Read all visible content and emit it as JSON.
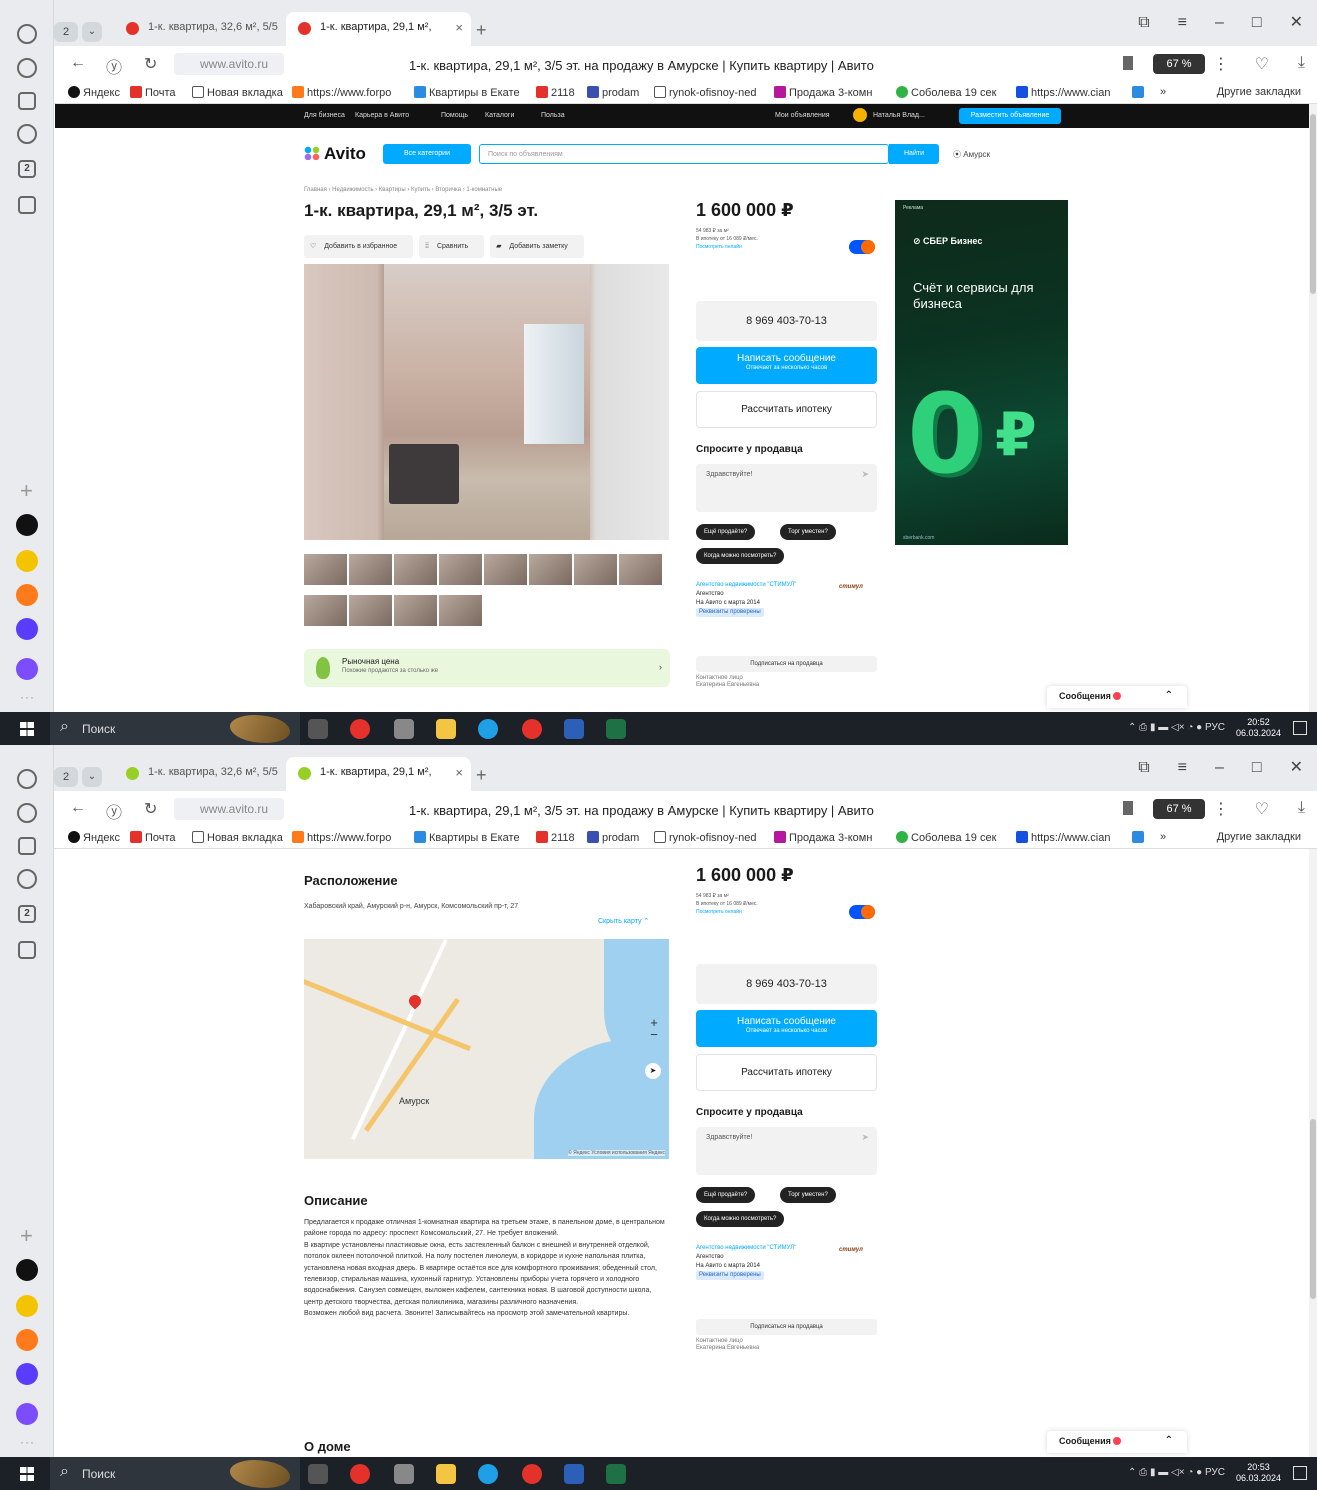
{
  "browser": {
    "tab_count": "2",
    "tab_inactive_title": "1-к. квартира, 32,6 м², 5/5",
    "tab_active_title": "1-к. квартира, 29,1 м², ",
    "url": "www.avito.ru",
    "page_title": "1-к. квартира, 29,1 м², 3/5 эт. на продажу в Амурске | Купить квартиру | Авито",
    "zoom": "67 %",
    "bookmarks": [
      "Яндекс",
      "Почта",
      "Новая вкладка",
      "https://www.forpo",
      "Квартиры в Екате",
      "2118",
      "prodam",
      "rynok-ofisnoy-ned",
      "Продажа 3-комн",
      "Соболева 19 сек",
      "https://www.cian",
      "»"
    ],
    "bookmarks_other": "Другие закладки"
  },
  "avito": {
    "top_links": [
      "Для бизнеса",
      "Карьера в Авито",
      "Помощь",
      "Каталоги",
      "Польза"
    ],
    "my_ads": "Мои объявления",
    "user": "Наталья Влад...",
    "post_ad": "Разместить объявление",
    "logo": "Avito",
    "all_categories": "Все категории",
    "search_placeholder": "Поиск по объявлениям",
    "find": "Найти",
    "location": "Амурск",
    "breadcrumbs": "Главная › Недвижимость › Квартиры › Купить › Вторичка › 1-комнатные",
    "title": "1-к. квартира, 29,1 м², 3/5 эт.",
    "actions": [
      "Добавить в избранное",
      "Сравнить",
      "Добавить заметку"
    ],
    "market_title": "Рыночная цена",
    "market_sub": "Похожие продаются за столько же"
  },
  "sidebar": {
    "price": "1 600 000 ₽",
    "per_m2": "54 983 ₽ за м²",
    "mortgage_line": "В ипотеку от 16 089 ₽/мес.",
    "mortgage_link": "Посмотреть онлайн",
    "phone": "8 969 403-70-13",
    "write_message": "Написать сообщение",
    "write_sub": "Отвечает за несколько часов",
    "calc_mortgage": "Рассчитать ипотеку",
    "ask_heading": "Спросите у продавца",
    "ask_placeholder": "Здравствуйте!",
    "chips": [
      "Ещё продаёте?",
      "Торг уместен?",
      "Когда можно посмотреть?"
    ],
    "agency_name": "Агентство недвижимости \"СТИМУЛ\"",
    "agency_type": "Агентство",
    "agency_since": "На Авито с марта 2014",
    "agency_badge": "Реквизиты проверены",
    "agency_logo": "стимул",
    "subscribe": "Подписаться на продавца",
    "contact_label": "Контактное лицо",
    "contact_name": "Екатерина Евгеньевна"
  },
  "ad_banner": {
    "label": "Реклама",
    "brand": "СБЕР Бизнес",
    "headline": "Счёт и сервисы для бизнеса",
    "big": "0",
    "currency": "₽",
    "footer": "sberbank.com"
  },
  "messages": {
    "label": "Сообщения"
  },
  "location_section": {
    "heading": "Расположение",
    "address": "Хабаровский край, Амурский р-н, Амурск, Комсомольский пр-т, 27",
    "hide_map": "Скрыть карту",
    "city_label": "Амурск",
    "map_copyright": "© Яндекс Условия использования Яндекс"
  },
  "description_section": {
    "heading": "Описание",
    "paragraphs": [
      "Предлагается к продаже отличная 1-комнатная квартира на третьем этаже, в панельном доме, в центральном районе города по адресу: проспект Комсомольский, 27. Не требует вложений.",
      "В квартире установлены пластиковые окна, есть застекленный балкон с внешней и внутренней отделкой, потолок оклеен потолочной плиткой. На полу постелен линолеум, в коридоре и кухне напольная плитка, установлена новая входная дверь. В квартире остаётся все для комфортного проживания: обеденный стол, телевизор, стиральная машина, кухонный гарнитур. Установлены приборы учета горячего и холодного водоснабжения. Санузел совмещен, выложен кафелем, сантехника новая. В шаговой доступности школа, центр детского творчества, детская поликлиника, магазины различного назначения.",
      "Возможен любой вид расчета. Звоните! Записывайтесь на просмотр этой замечательной квартиры."
    ]
  },
  "about_house": {
    "heading": "О доме"
  },
  "taskbar": {
    "search": "Поиск",
    "lang": "РУС",
    "time1": "20:52",
    "time2": "20:53",
    "date": "06.03.2024"
  }
}
